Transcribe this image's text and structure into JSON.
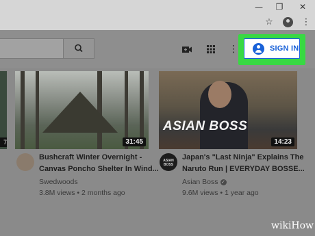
{
  "browser": {
    "minimize_icon": "minimize-icon",
    "restore_icon": "restore-icon",
    "close_icon": "close-icon",
    "bookmark_icon": "star-icon",
    "profile_icon": "profile-icon",
    "menu_icon": "kebab-menu-icon"
  },
  "youtube_header": {
    "search_icon": "search-icon",
    "create_icon": "video-camera-icon",
    "apps_icon": "apps-grid-icon",
    "settings_icon": "kebab-menu-icon",
    "sign_in_label": "SIGN IN",
    "highlight_color": "#38d943",
    "accent_color": "#1a62d8"
  },
  "videos": [
    {
      "title_line1": "Bushcraft Winter Overnight -",
      "title_line2": "Canvas Poncho Shelter In Wind...",
      "channel": "Swedwoods",
      "meta": "3.8M views • 2 months ago",
      "duration": "31:45"
    },
    {
      "title_line1": "Japan's \"Last Ninja\" Explains The",
      "title_line2": "Naruto Run | EVERYDAY BOSSE...",
      "channel": "Asian Boss",
      "meta": "9.6M views • 1 year ago",
      "duration": "14:23",
      "thumbnail_text": "ASIAN BOSS",
      "avatar_text": "ASIAN BOSS",
      "verified_icon": "verified-check-icon"
    }
  ],
  "left_partial_duration": "7",
  "watermark": "wikiHow"
}
